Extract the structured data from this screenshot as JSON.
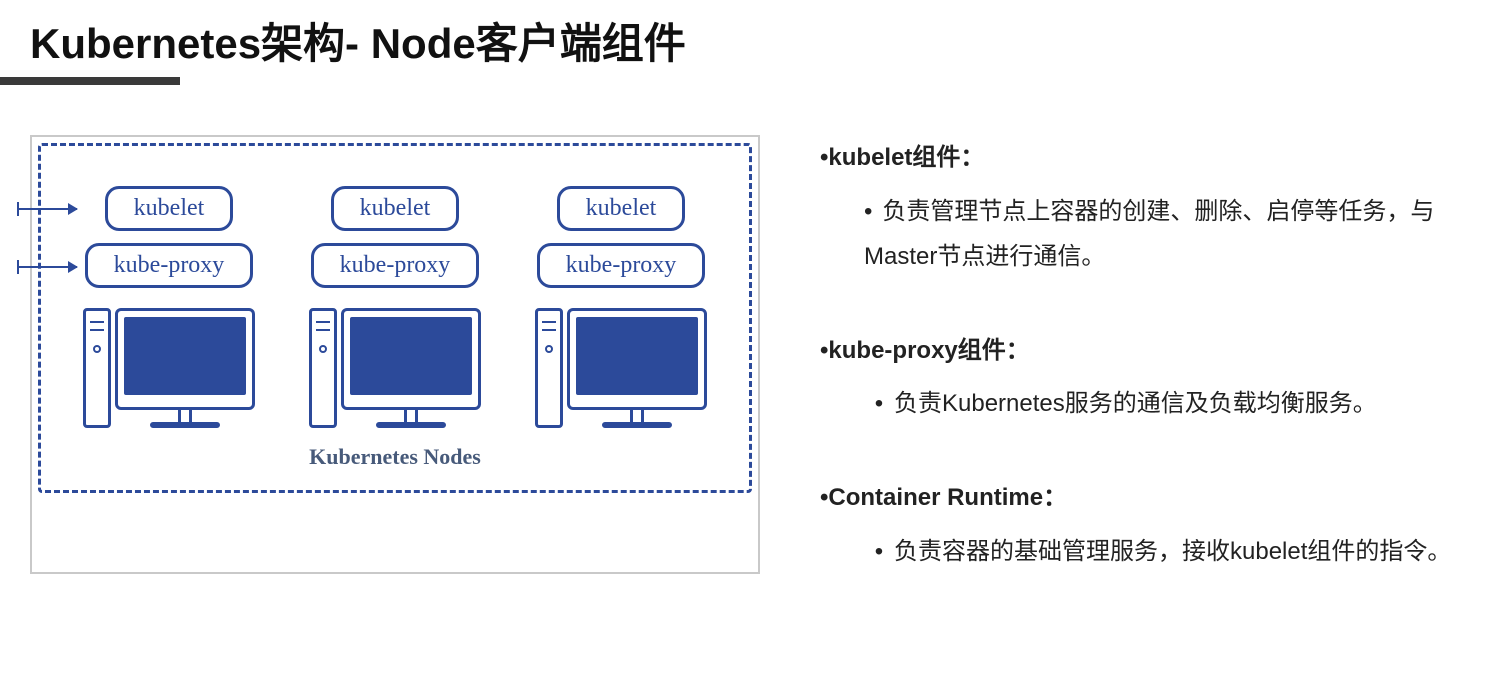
{
  "title": "Kubernetes架构- Node客户端组件",
  "diagram": {
    "pill_kubelet": "kubelet",
    "pill_kubeproxy": "kube-proxy",
    "nodes_label": "Kubernetes Nodes"
  },
  "components": [
    {
      "title": "•kubelet组件：",
      "desc_style": "dot",
      "desc": "负责管理节点上容器的创建、删除、启停等任务，与Master节点进行通信。"
    },
    {
      "title": "•kube-proxy组件：",
      "desc_style": "bullet",
      "desc": "负责Kubernetes服务的通信及负载均衡服务。"
    },
    {
      "title": "•Container Runtime：",
      "desc_style": "bullet",
      "desc": "负责容器的基础管理服务，接收kubelet组件的指令。"
    }
  ]
}
